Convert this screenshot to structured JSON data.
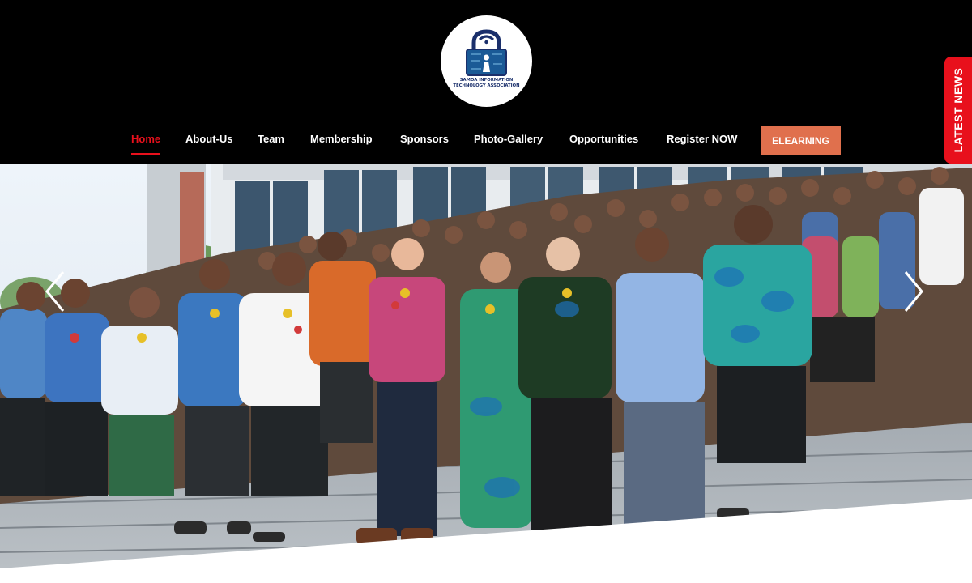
{
  "logo": {
    "line1": "SAMOA INFORMATION",
    "line2": "TECHNOLOGY ASSOCIATION"
  },
  "nav": {
    "items": [
      {
        "label": "Home",
        "active": true
      },
      {
        "label": "About-Us"
      },
      {
        "label": "Team"
      },
      {
        "label": "Membership"
      },
      {
        "label": "Sponsors"
      },
      {
        "label": "Photo-Gallery"
      },
      {
        "label": "Opportunities"
      },
      {
        "label": "Register NOW"
      }
    ],
    "elearning": "ELEARNING"
  },
  "latest_news": "LATEST NEWS",
  "hero": {
    "icons": [
      "chevron-left-icon",
      "chevron-right-icon"
    ]
  },
  "colors": {
    "header_bg": "#000000",
    "active_nav": "#e8101c",
    "elearning_bg": "#e0704d",
    "latest_news_bg": "#e8101c"
  }
}
